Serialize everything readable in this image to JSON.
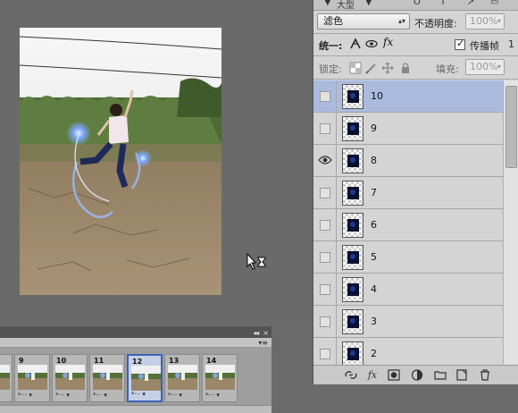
{
  "layers_panel": {
    "top_strip": [
      "▼",
      "大型",
      "▼",
      "O",
      "T",
      "↗",
      "▭"
    ],
    "blend_mode": "滤色",
    "opacity_label": "不透明度:",
    "opacity_value": "100%",
    "unify_label": "统一:",
    "propagate_label": "传播帧",
    "propagate_count": "1",
    "lock_label": "锁定:",
    "fill_label": "填充:",
    "fill_value": "100%",
    "layers": [
      {
        "name": "10",
        "visible": false,
        "selected": true
      },
      {
        "name": "9",
        "visible": false,
        "selected": false
      },
      {
        "name": "8",
        "visible": true,
        "selected": false
      },
      {
        "name": "7",
        "visible": false,
        "selected": false
      },
      {
        "name": "6",
        "visible": false,
        "selected": false
      },
      {
        "name": "5",
        "visible": false,
        "selected": false
      },
      {
        "name": "4",
        "visible": false,
        "selected": false
      },
      {
        "name": "3",
        "visible": false,
        "selected": false
      },
      {
        "name": "2",
        "visible": false,
        "selected": false
      }
    ],
    "footer_icons": [
      "link-icon",
      "fx-icon",
      "mask-icon",
      "adjustment-icon",
      "group-folder-icon",
      "new-layer-icon",
      "trash-icon"
    ]
  },
  "timeline": {
    "collapse_glyph": "◂◂",
    "close_glyph": "×",
    "menu_glyph": "▾≡",
    "frames": [
      {
        "number": "",
        "foot": "*··· ▾",
        "selected": false
      },
      {
        "number": "9",
        "foot": "*··· ▾",
        "selected": false
      },
      {
        "number": "10",
        "foot": "*··· ▾",
        "selected": false
      },
      {
        "number": "11",
        "foot": "*··· ▾",
        "selected": false
      },
      {
        "number": "12",
        "foot": "*··· ▾",
        "selected": true
      },
      {
        "number": "13",
        "foot": "*··· ▾",
        "selected": false
      },
      {
        "number": "14",
        "foot": "*··· ▾",
        "selected": false
      }
    ]
  },
  "colors": {
    "workspace": "#6b6b6b",
    "panel_bg": "#d4d4d4",
    "selected_layer": "#aabbde",
    "selected_frame_border": "#3a62b6"
  }
}
